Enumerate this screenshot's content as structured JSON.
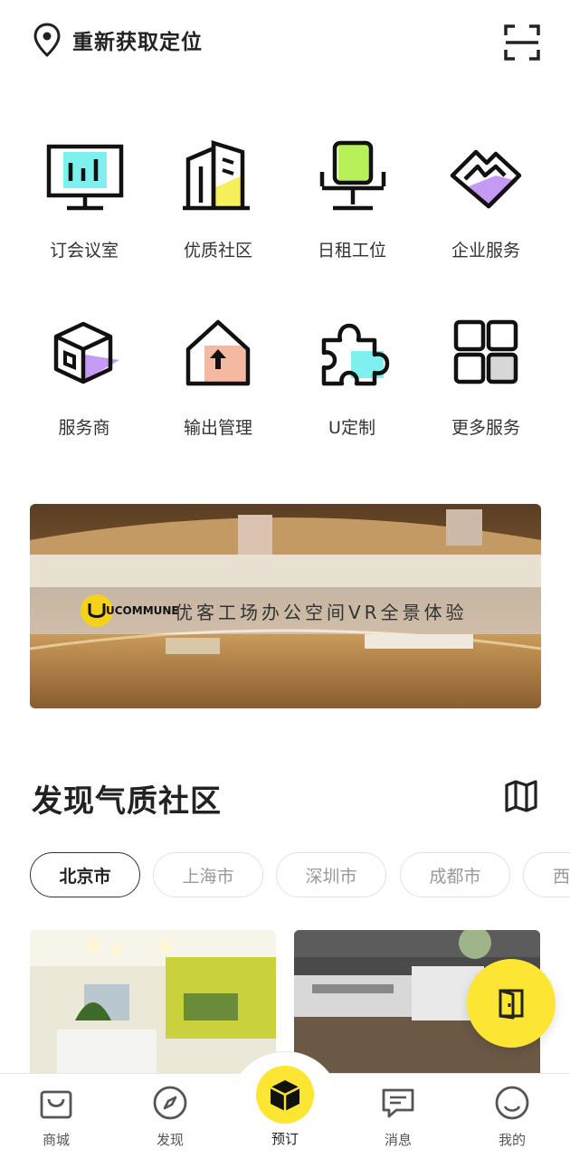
{
  "header": {
    "location_label": "重新获取定位",
    "location_icon": "location-pin-icon",
    "scan_icon": "scan-icon"
  },
  "services": [
    {
      "label": "订会议室",
      "icon": "meeting-room-icon",
      "accent": "#7ef0f0"
    },
    {
      "label": "优质社区",
      "icon": "building-icon",
      "accent": "#f5f05a"
    },
    {
      "label": "日租工位",
      "icon": "office-chair-icon",
      "accent": "#b8f05a"
    },
    {
      "label": "企业服务",
      "icon": "enterprise-service-icon",
      "accent": "#c59af5"
    },
    {
      "label": "服务商",
      "icon": "service-provider-box-icon",
      "accent": "#c59af5"
    },
    {
      "label": "输出管理",
      "icon": "output-management-house-icon",
      "accent": "#f5b9a2"
    },
    {
      "label": "U定制",
      "icon": "puzzle-icon",
      "accent": "#7ef0f0"
    },
    {
      "label": "更多服务",
      "icon": "more-services-grid-icon",
      "accent": "#d7d7d7"
    }
  ],
  "banner": {
    "logo_text": "UCOMMUNE",
    "title": "优客工场办公空间VR全景体验"
  },
  "discover": {
    "title": "发现气质社区",
    "map_icon": "map-icon",
    "cities": [
      "北京市",
      "上海市",
      "深圳市",
      "成都市",
      "西"
    ]
  },
  "bottom_nav": {
    "items": [
      {
        "label": "商城",
        "icon": "shopping-bag-icon"
      },
      {
        "label": "发现",
        "icon": "compass-icon"
      },
      {
        "label": "预订",
        "icon": "cube-icon"
      },
      {
        "label": "消息",
        "icon": "message-icon"
      },
      {
        "label": "我的",
        "icon": "profile-icon"
      }
    ]
  },
  "colors": {
    "brand_yellow": "#fde534",
    "text_dark": "#222222",
    "text_muted": "#999999"
  }
}
